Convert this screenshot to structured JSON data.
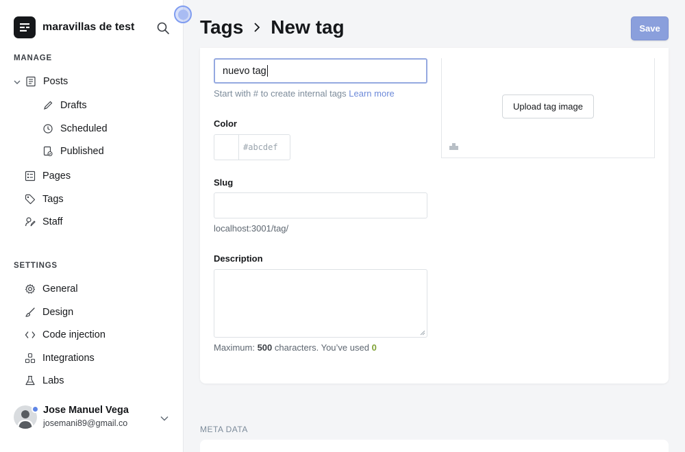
{
  "sidebar": {
    "brand_name": "maravillas de test",
    "sections": {
      "manage": "MANAGE",
      "settings": "SETTINGS"
    },
    "manage_items": {
      "posts": "Posts",
      "drafts": "Drafts",
      "scheduled": "Scheduled",
      "published": "Published",
      "pages": "Pages",
      "tags": "Tags",
      "staff": "Staff"
    },
    "settings_items": {
      "general": "General",
      "design": "Design",
      "code_injection": "Code injection",
      "integrations": "Integrations",
      "labs": "Labs"
    },
    "user": {
      "name": "Jose Manuel Vega",
      "email": "josemani89@gmail.co"
    }
  },
  "header": {
    "breadcrumb_parent": "Tags",
    "breadcrumb_current": "New tag",
    "save_label": "Save"
  },
  "form": {
    "name_value": "nuevo tag",
    "name_hint": "Start with # to create internal tags",
    "learn_more": "Learn more",
    "color_label": "Color",
    "color_placeholder": "#abcdef",
    "slug_label": "Slug",
    "slug_value": "",
    "slug_hint": "localhost:3001/tag/",
    "description_label": "Description",
    "description_value": "",
    "counter_prefix": "Maximum:",
    "counter_max": "500",
    "counter_middle": "characters. You’ve used",
    "counter_used": "0",
    "upload_label": "Upload tag image"
  },
  "meta": {
    "section_label": "META DATA"
  },
  "colors": {
    "accent": "#8a9fdc",
    "link": "#6d8ad9",
    "counter_ok": "#7fa235"
  }
}
